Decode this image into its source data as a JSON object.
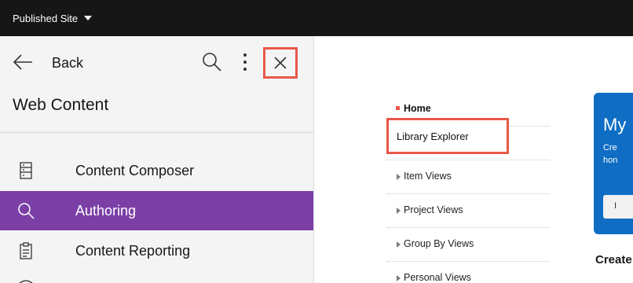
{
  "topbar": {
    "site_label": "Published Site",
    "site_icon": "chevron-down-icon"
  },
  "sidebar": {
    "back_label": "Back",
    "title": "Web Content",
    "icons": {
      "back": "arrow-left-icon",
      "search": "search-icon",
      "more": "overflow-menu-icon",
      "close": "close-icon"
    },
    "items": [
      {
        "label": "Content Composer",
        "icon": "document-list-icon",
        "active": false
      },
      {
        "label": "Authoring",
        "icon": "search-icon",
        "active": true
      },
      {
        "label": "Content Reporting",
        "icon": "clipboard-icon",
        "active": false
      }
    ],
    "accent_color": "#7b3fa6"
  },
  "main": {
    "menu": [
      {
        "label": "Home",
        "current": true
      },
      {
        "label": "Library Explorer",
        "highlighted": true
      },
      {
        "label": "Item Views"
      },
      {
        "label": "Project Views"
      },
      {
        "label": "Group By Views"
      },
      {
        "label": "Personal Views"
      }
    ],
    "card": {
      "title": "My",
      "line1": "Cre",
      "line2": "hon",
      "button": "I",
      "color": "#0f6ec4"
    },
    "create_heading": "Create"
  },
  "highlight_color": "#e8584a"
}
